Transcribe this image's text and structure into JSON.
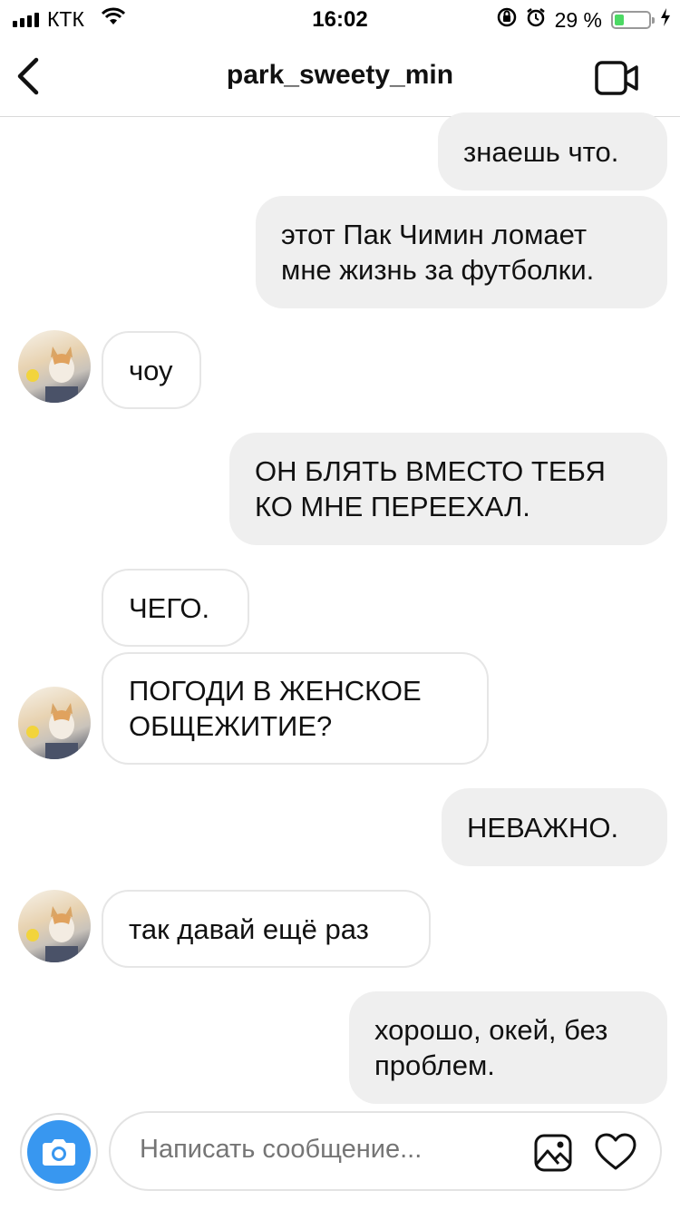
{
  "status_bar": {
    "carrier": "КТК",
    "time": "16:02",
    "battery": "29 %",
    "battery_level": 0.29
  },
  "header": {
    "title": "park_sweety_min",
    "back_icon": "chevron-left-icon",
    "video_icon": "video-camera-icon"
  },
  "messages": [
    {
      "direction": "out",
      "text": "знаешь что."
    },
    {
      "direction": "out",
      "text": "этот Пак Чимин ломает мне жизнь за футболки."
    },
    {
      "direction": "in",
      "text": "чоу"
    },
    {
      "direction": "out",
      "text": "ОН БЛЯТЬ ВМЕСТО ТЕБЯ КО МНЕ ПЕРЕЕХАЛ."
    },
    {
      "direction": "in",
      "text": "ЧЕГО."
    },
    {
      "direction": "in",
      "text": "ПОГОДИ В ЖЕНСКОЕ ОБЩЕЖИТИЕ?"
    },
    {
      "direction": "out",
      "text": "НЕВАЖНО."
    },
    {
      "direction": "in",
      "text": "так давай ещё раз"
    },
    {
      "direction": "out",
      "text": "хорошо, окей, без проблем."
    }
  ],
  "composer": {
    "placeholder": "Написать сообщение...",
    "camera_icon": "camera-icon",
    "gallery_icon": "image-icon",
    "like_icon": "heart-icon"
  },
  "colors": {
    "accent": "#3897f0",
    "outgoing_bubble": "#efefef",
    "battery_fill": "#4cd964"
  }
}
